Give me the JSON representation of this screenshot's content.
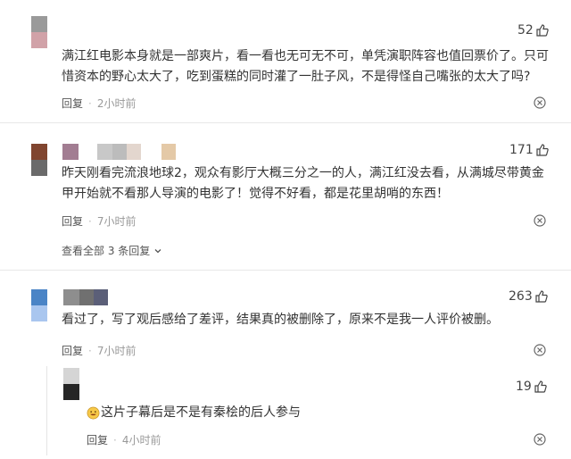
{
  "comments": [
    {
      "text_lines": [
        "满江红电影本身就是一部爽片，看一看也无可无不可，单凭演职阵容也值回票价了。只可",
        "惜资本的野心太大了，吃到蛋糕的同时灌了一肚子风，不是得怪自己嘴张的太大了吗?"
      ],
      "likes": "52",
      "reply_label": "回复",
      "time": "2小时前",
      "avatar_colors": [
        "#9a9a9a",
        "#d1a2a8"
      ],
      "name_colors": []
    },
    {
      "text_lines": [
        "昨天刚看完流浪地球2，观众有影厅大概三分之一的人，满江红没去看，从满城尽带黄金",
        "甲开始就不看那人导演的电影了！觉得不好看，都是花里胡哨的东西！"
      ],
      "likes": "171",
      "reply_label": "回复",
      "time": "7小时前",
      "avatar_colors": [
        "#80452f",
        "#6a6a6a"
      ],
      "name_colors": [
        "#a27d92",
        "#c8c8c8",
        "#bcbcbc",
        "#e3d6ce",
        "#e4c9a7"
      ],
      "view_all": "查看全部 3 条回复"
    },
    {
      "text_lines": [
        "看过了，写了观后感给了差评，结果真的被删除了，原来不是我一人评价被删。"
      ],
      "likes": "263",
      "reply_label": "回复",
      "time": "7小时前",
      "avatar_colors": [
        "#4a84c6",
        "#a9c6ef"
      ],
      "name_colors": [
        "#8e8e8e",
        "#707070",
        "#5b5f78"
      ]
    }
  ],
  "reply": {
    "emoji_icon": "grinning-face-emoji",
    "text": "这片子幕后是不是有秦桧的后人参与",
    "likes": "19",
    "reply_label": "回复",
    "time": "4小时前",
    "avatar_colors": [
      "#d5d5d5",
      "#262626"
    ]
  },
  "colors": {
    "text": "#333333",
    "meta": "#999999",
    "divider": "#e8e8e8"
  }
}
